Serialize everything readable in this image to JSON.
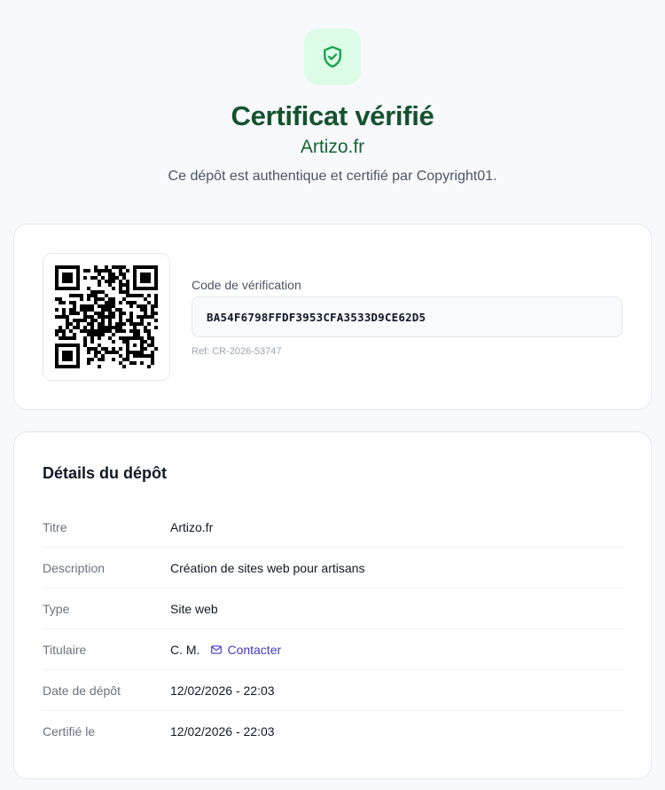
{
  "header": {
    "badge_icon": "shield-check-icon",
    "title": "Certificat vérifié",
    "subtitle": "Artizo.fr",
    "description": "Ce dépôt est authentique et certifié par Copyright01."
  },
  "verification": {
    "qr_icon": "qr-code-icon",
    "code_label": "Code de vérification",
    "code_value": "BA54F6798FFDF3953CFA3533D9CE62D5",
    "ref": "Ref: CR-2026-53747"
  },
  "details": {
    "title": "Détails du dépôt",
    "rows": [
      {
        "label": "Titre",
        "value": "Artizo.fr"
      },
      {
        "label": "Description",
        "value": "Création de sites web pour artisans"
      },
      {
        "label": "Type",
        "value": "Site web"
      },
      {
        "label": "Titulaire",
        "value": "C. M.",
        "link_label": "Contacter",
        "link_icon": "mail-icon"
      },
      {
        "label": "Date de dépôt",
        "value": "12/02/2026 - 22:03"
      },
      {
        "label": "Certifié le",
        "value": "12/02/2026 - 22:03"
      }
    ]
  },
  "colors": {
    "accent_green": "#14532d",
    "badge_bg": "#dcfce7",
    "link": "#4338ca"
  }
}
